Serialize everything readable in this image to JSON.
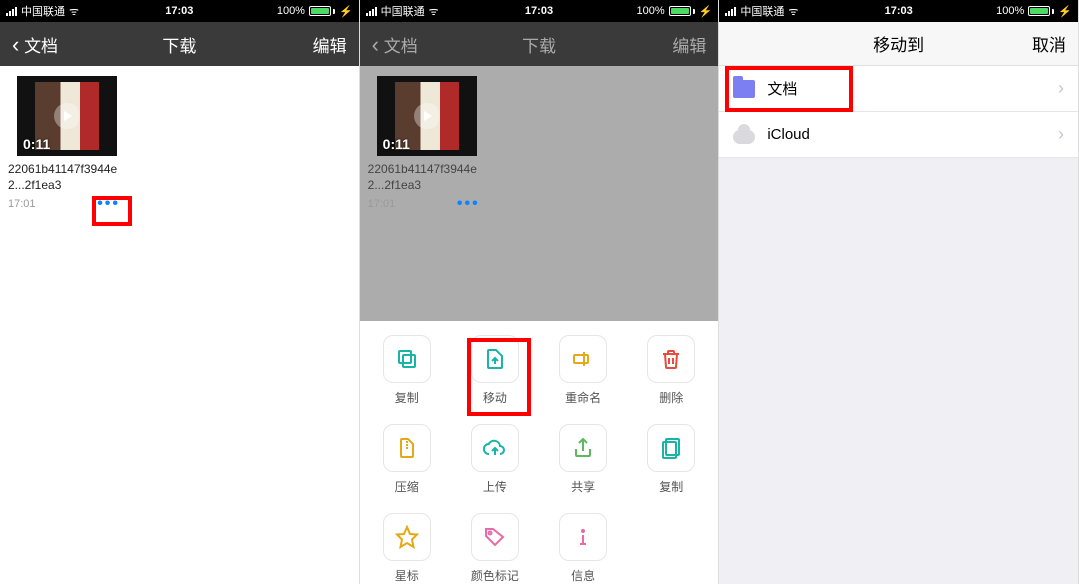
{
  "status": {
    "carrier": "中国联通",
    "time": "17:03",
    "battery_pct": "100%"
  },
  "screen1": {
    "nav": {
      "back": "文档",
      "title": "下载",
      "right": "编辑"
    },
    "file": {
      "duration": "0:11",
      "name": "22061b41147f3944e2...2f1ea3",
      "time": "17:01",
      "more": "•••"
    }
  },
  "screen2": {
    "nav": {
      "back": "文档",
      "title": "下载",
      "right": "编辑"
    },
    "file": {
      "duration": "0:11",
      "name": "22061b41147f3944e2...2f1ea3",
      "time": "17:01",
      "more": "•••"
    },
    "actions": {
      "copy": "复制",
      "move": "移动",
      "rename": "重命名",
      "delete": "删除",
      "compress": "压缩",
      "upload": "上传",
      "share": "共享",
      "duplicate": "复制",
      "star": "星标",
      "color_tag": "颜色标记",
      "info": "信息"
    }
  },
  "screen3": {
    "nav": {
      "title": "移动到",
      "right": "取消"
    },
    "rows": {
      "documents": "文档",
      "icloud": "iCloud"
    }
  }
}
